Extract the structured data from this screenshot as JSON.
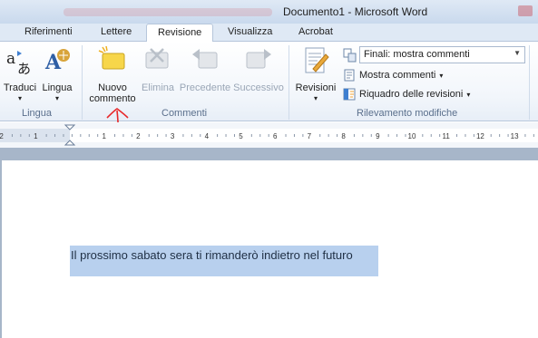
{
  "window": {
    "title": "Documento1 - Microsoft Word"
  },
  "tabs": [
    {
      "label": "Riferimenti",
      "active": false
    },
    {
      "label": "Lettere",
      "active": false
    },
    {
      "label": "Revisione",
      "active": true
    },
    {
      "label": "Visualizza",
      "active": false
    },
    {
      "label": "Acrobat",
      "active": false
    }
  ],
  "ribbon": {
    "lingua": {
      "group_label": "Lingua",
      "traduci": "Traduci",
      "lingua": "Lingua"
    },
    "commenti": {
      "group_label": "Commenti",
      "nuovo_line1": "Nuovo",
      "nuovo_line2": "commento",
      "elimina": "Elimina",
      "precedente": "Precedente",
      "successivo": "Successivo"
    },
    "rilevamento": {
      "group_label": "Rilevamento modifiche",
      "revisioni": "Revisioni",
      "display_for_review": "Finali: mostra commenti",
      "mostra_commenti": "Mostra commenti",
      "riquadro": "Riquadro delle revisioni"
    }
  },
  "ruler": {
    "labels": [
      "2",
      "1",
      "1",
      "2",
      "3",
      "4",
      "5",
      "6",
      "7",
      "8",
      "9",
      "10",
      "11",
      "12",
      "13"
    ]
  },
  "document": {
    "text": "Il prossimo sabato sera ti rimanderò indietro nel futuro"
  },
  "colors": {
    "annotation_arrow": "#e8282a",
    "selection": "#b8d0ee"
  }
}
